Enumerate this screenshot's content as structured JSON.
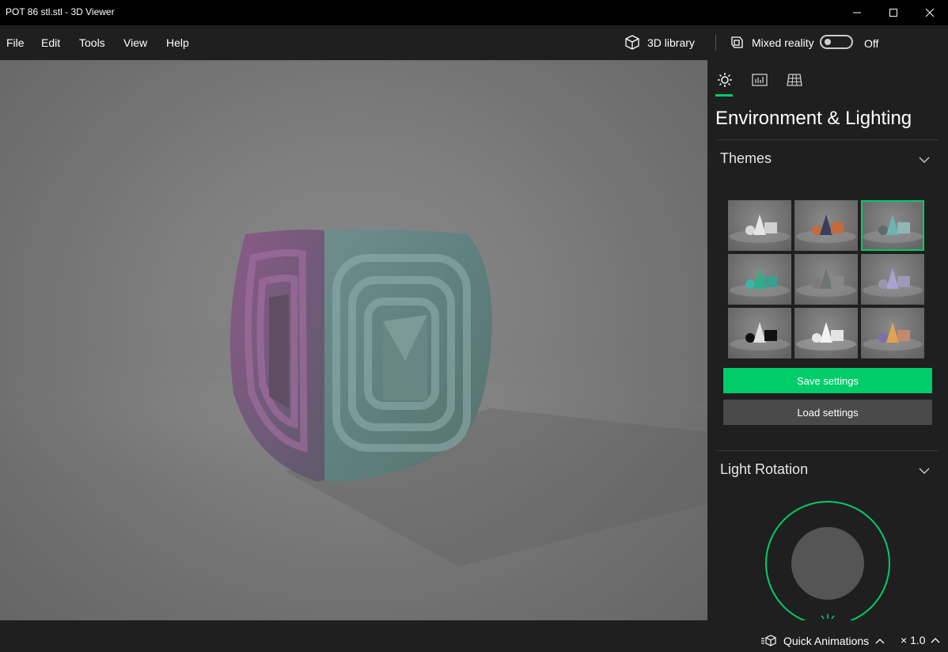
{
  "window": {
    "title": "POT 86 stl.stl - 3D Viewer"
  },
  "menu": {
    "items": [
      "File",
      "Edit",
      "Tools",
      "View",
      "Help"
    ]
  },
  "toolbar": {
    "library_label": "3D library",
    "mixed_reality_label": "Mixed reality",
    "mixed_reality_state": "Off"
  },
  "panel": {
    "tabs": [
      "environment-icon",
      "stats-icon",
      "grid-icon"
    ],
    "active_tab": 0,
    "title": "Environment & Lighting",
    "themes": {
      "label": "Themes",
      "selected_index": 2,
      "items": [
        {
          "name": "white"
        },
        {
          "name": "orange-navy"
        },
        {
          "name": "teal"
        },
        {
          "name": "green"
        },
        {
          "name": "gray"
        },
        {
          "name": "lavender"
        },
        {
          "name": "black-white"
        },
        {
          "name": "light-white"
        },
        {
          "name": "multicolor"
        }
      ]
    },
    "save_label": "Save settings",
    "load_label": "Load settings",
    "light_rotation_label": "Light Rotation"
  },
  "colors": {
    "accent": "#00cc6a",
    "panel_bg": "#1f1f1f",
    "viewport_bg": "#7d7d7d"
  },
  "status": {
    "animations_label": "Quick Animations",
    "speed": "× 1.0"
  }
}
